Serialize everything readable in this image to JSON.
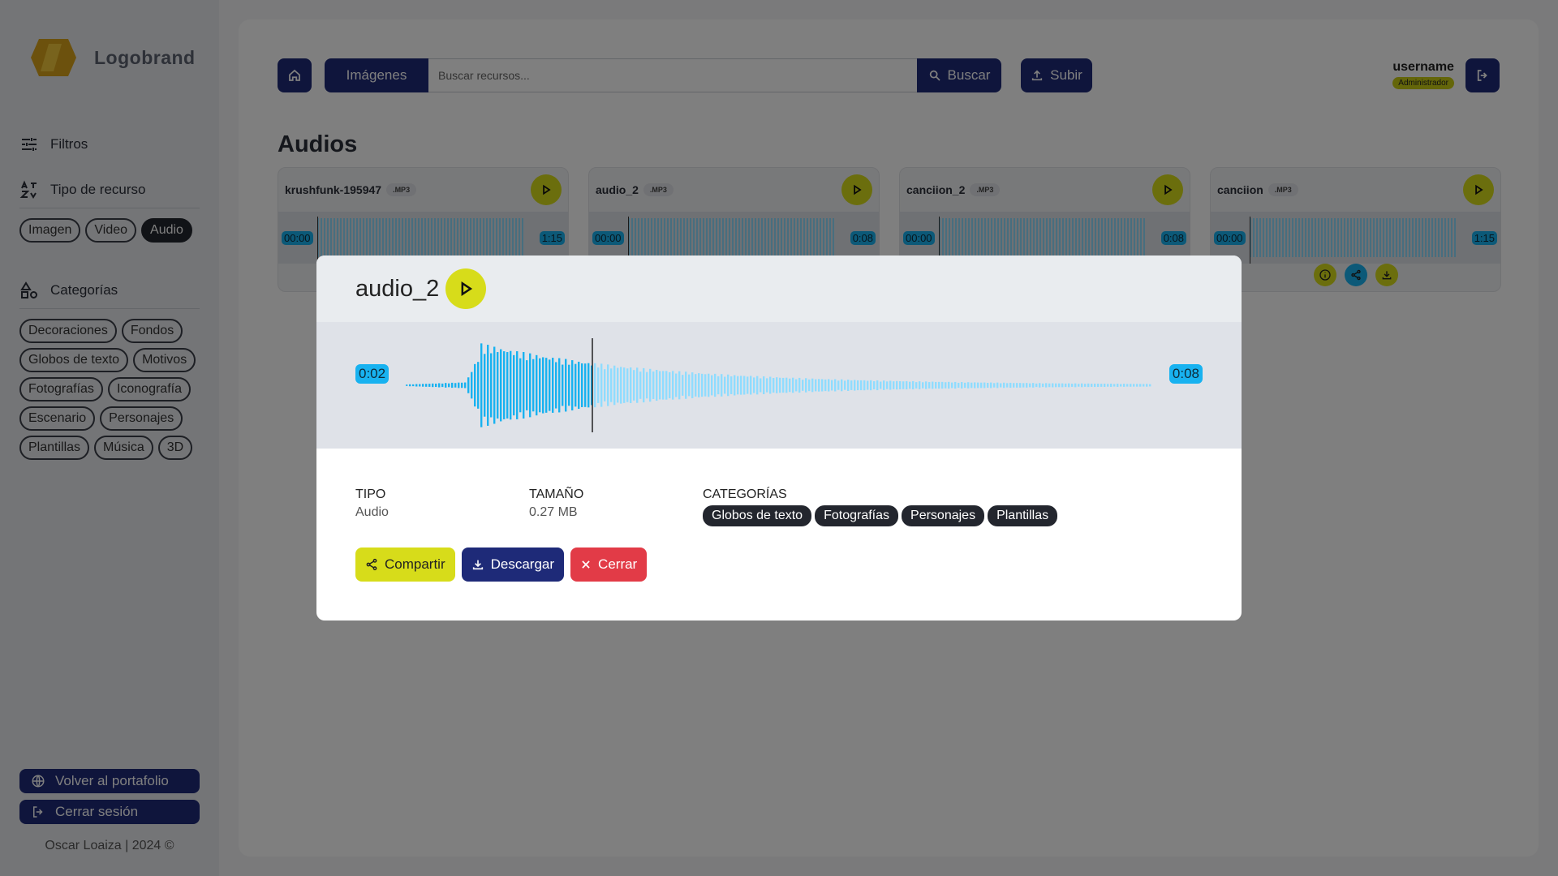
{
  "brand": {
    "name": "Logobrand"
  },
  "sidebar": {
    "filters_label": "Filtros",
    "resource_type_label": "Tipo de recurso",
    "resource_types": [
      {
        "label": "Imagen",
        "active": false
      },
      {
        "label": "Video",
        "active": false
      },
      {
        "label": "Audio",
        "active": true
      }
    ],
    "categories_label": "Categorías",
    "categories": [
      "Decoraciones",
      "Fondos",
      "Globos de texto",
      "Motivos",
      "Fotografías",
      "Iconografía",
      "Escenario",
      "Personajes",
      "Plantillas",
      "Música",
      "3D"
    ],
    "portfolio_button": "Volver al portafolio",
    "logout_button": "Cerrar sesión",
    "footer": "Oscar Loaiza | 2024 ©"
  },
  "topbar": {
    "search_type": "Imágenes",
    "search_placeholder": "Buscar recursos...",
    "search_button": "Buscar",
    "upload_button": "Subir",
    "username": "username",
    "role": "Administrador"
  },
  "page": {
    "title": "Audios"
  },
  "cards": [
    {
      "name": "krushfunk-195947",
      "ext": ".MP3",
      "start": "00:00",
      "end": "1:15"
    },
    {
      "name": "audio_2",
      "ext": ".MP3",
      "start": "00:00",
      "end": "0:08"
    },
    {
      "name": "canciion_2",
      "ext": ".MP3",
      "start": "00:00",
      "end": "0:08"
    },
    {
      "name": "canciion",
      "ext": ".MP3",
      "start": "00:00",
      "end": "1:15"
    }
  ],
  "modal": {
    "title": "audio_2",
    "current_time": "0:02",
    "total_time": "0:08",
    "playback_progress": 0.25,
    "type_label": "TIPO",
    "type_value": "Audio",
    "size_label": "TAMAÑO",
    "size_value": "0.27 MB",
    "categories_label": "CATEGORÍAS",
    "categories": [
      "Globos de texto",
      "Fotografías",
      "Personajes",
      "Plantillas"
    ],
    "share_button": "Compartir",
    "download_button": "Descargar",
    "close_button": "Cerrar"
  },
  "colors": {
    "primary": "#1e2a78",
    "accent": "#d7dc1a",
    "wave_played": "#18b2f0",
    "wave_unplayed": "#8fdcff",
    "danger": "#e23b47"
  }
}
